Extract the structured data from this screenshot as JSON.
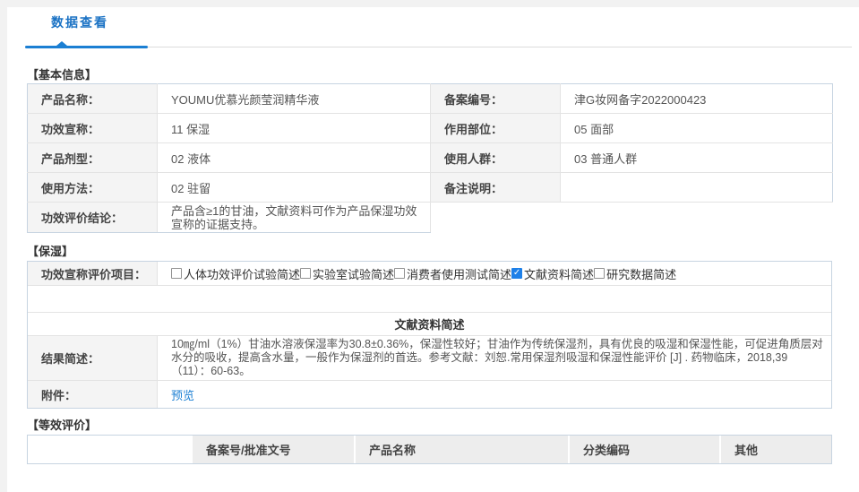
{
  "page": {
    "tab_label": "数据查看"
  },
  "colors": {
    "accent_blue": "#1b7fd3",
    "link_blue": "#1b7fd3",
    "checkbox_checked_blue": "#1e80e8"
  },
  "basic_info": {
    "section_title": "【基本信息】",
    "fields": {
      "product_name": {
        "label": "产品名称：",
        "value": "YOUMU优慕光颜莹润精华液"
      },
      "record_number": {
        "label": "备案编号：",
        "value": "津G妆网备字2022000423"
      },
      "efficacy_claim": {
        "label": "功效宣称：",
        "value": "11 保湿"
      },
      "apply_part": {
        "label": "作用部位：",
        "value": "05 面部"
      },
      "product_form": {
        "label": "产品剂型：",
        "value": "02 液体"
      },
      "target_users": {
        "label": "使用人群：",
        "value": "03 普通人群"
      },
      "usage_method": {
        "label": "使用方法：",
        "value": "02 驻留"
      },
      "remarks": {
        "label": "备注说明：",
        "value": ""
      },
      "conclusion": {
        "label": "功效评价结论：",
        "value": "产品含≥1的甘油，文献资料可作为产品保湿功效宣称的证据支持。"
      }
    }
  },
  "moisturizing": {
    "section_title": "【保湿】",
    "evaluation_items_label": "功效宣称评价项目：",
    "checkboxes": [
      {
        "label": "人体功效评价试验简述",
        "checked": false
      },
      {
        "label": "实验室试验简述",
        "checked": false
      },
      {
        "label": "消费者使用测试简述",
        "checked": false
      },
      {
        "label": "文献资料简述",
        "checked": true
      },
      {
        "label": "研究数据简述",
        "checked": false
      }
    ],
    "subsection_title": "文献资料简述",
    "result_label": "结果简述：",
    "result_text": "10㎎/ml（1%）甘油水溶液保湿率为30.8±0.36%，保湿性较好；甘油作为传统保湿剂，具有优良的吸湿和保湿性能，可促进角质层对水分的吸收，提高含水量，一般作为保湿剂的首选。参考文献：刘恕.常用保湿剂吸湿和保湿性能评价 [J] . 药物临床，2018,39（11）：60-63。",
    "attachment_label": "附件：",
    "attachment_link": "预览"
  },
  "equivalence": {
    "section_title": "【等效评价】",
    "headers": [
      "备案号/批准文号",
      "产品名称",
      "分类编码",
      "其他"
    ]
  }
}
